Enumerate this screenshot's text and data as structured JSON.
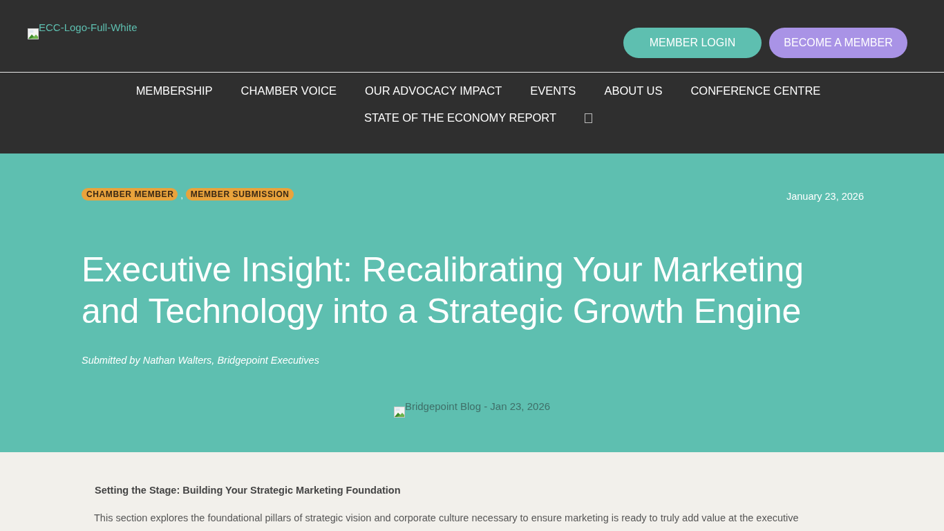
{
  "header": {
    "logo": {
      "alt": "ECC-Logo-Full-White"
    },
    "buttons": [
      {
        "label": "MEMBER LOGIN",
        "kind": "login"
      },
      {
        "label": "BECOME A MEMBER",
        "kind": "join"
      }
    ]
  },
  "nav": {
    "items": [
      {
        "label": "MEMBERSHIP"
      },
      {
        "label": "CHAMBER VOICE"
      },
      {
        "label": "OUR ADVOCACY IMPACT"
      },
      {
        "label": "EVENTS"
      },
      {
        "label": "ABOUT US"
      },
      {
        "label": "CONFERENCE CENTRE"
      },
      {
        "label": "STATE OF THE ECONOMY REPORT"
      }
    ]
  },
  "hero": {
    "tags": [
      "CHAMBER MEMBER",
      "MEMBER SUBMISSION"
    ],
    "tag_separator": ",",
    "date": "January 23, 2026",
    "title": "Executive Insight: Recalibrating Your Marketing and Technology into a Strategic Growth Engine",
    "byline": "Submitted by Nathan Walters, Bridgepoint Executives",
    "image": {
      "alt": "Bridgepoint Blog - Jan 23, 2026"
    }
  },
  "article": {
    "heading": "Setting the Stage: Building Your Strategic Marketing Foundation",
    "paragraph": "This section explores the foundational pillars of strategic vision and corporate culture necessary to ensure marketing is ready to truly add value at the executive"
  }
}
